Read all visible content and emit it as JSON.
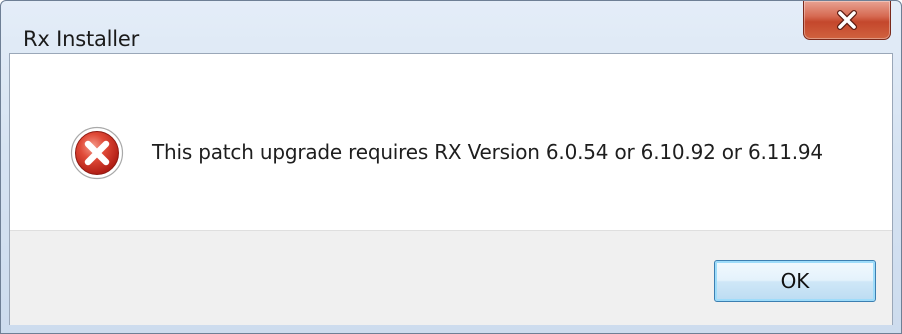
{
  "window": {
    "title": "Rx Installer",
    "close_icon": "close-icon"
  },
  "message": {
    "icon": "error-icon",
    "text": "This patch upgrade requires RX Version 6.0.54 or 6.10.92 or 6.11.94"
  },
  "buttons": {
    "ok_label": "OK"
  },
  "colors": {
    "close_button": "#c4472c",
    "error_icon": "#d8332a",
    "ok_border": "#3c7fb1",
    "title_bar": "#d6e3f2"
  }
}
